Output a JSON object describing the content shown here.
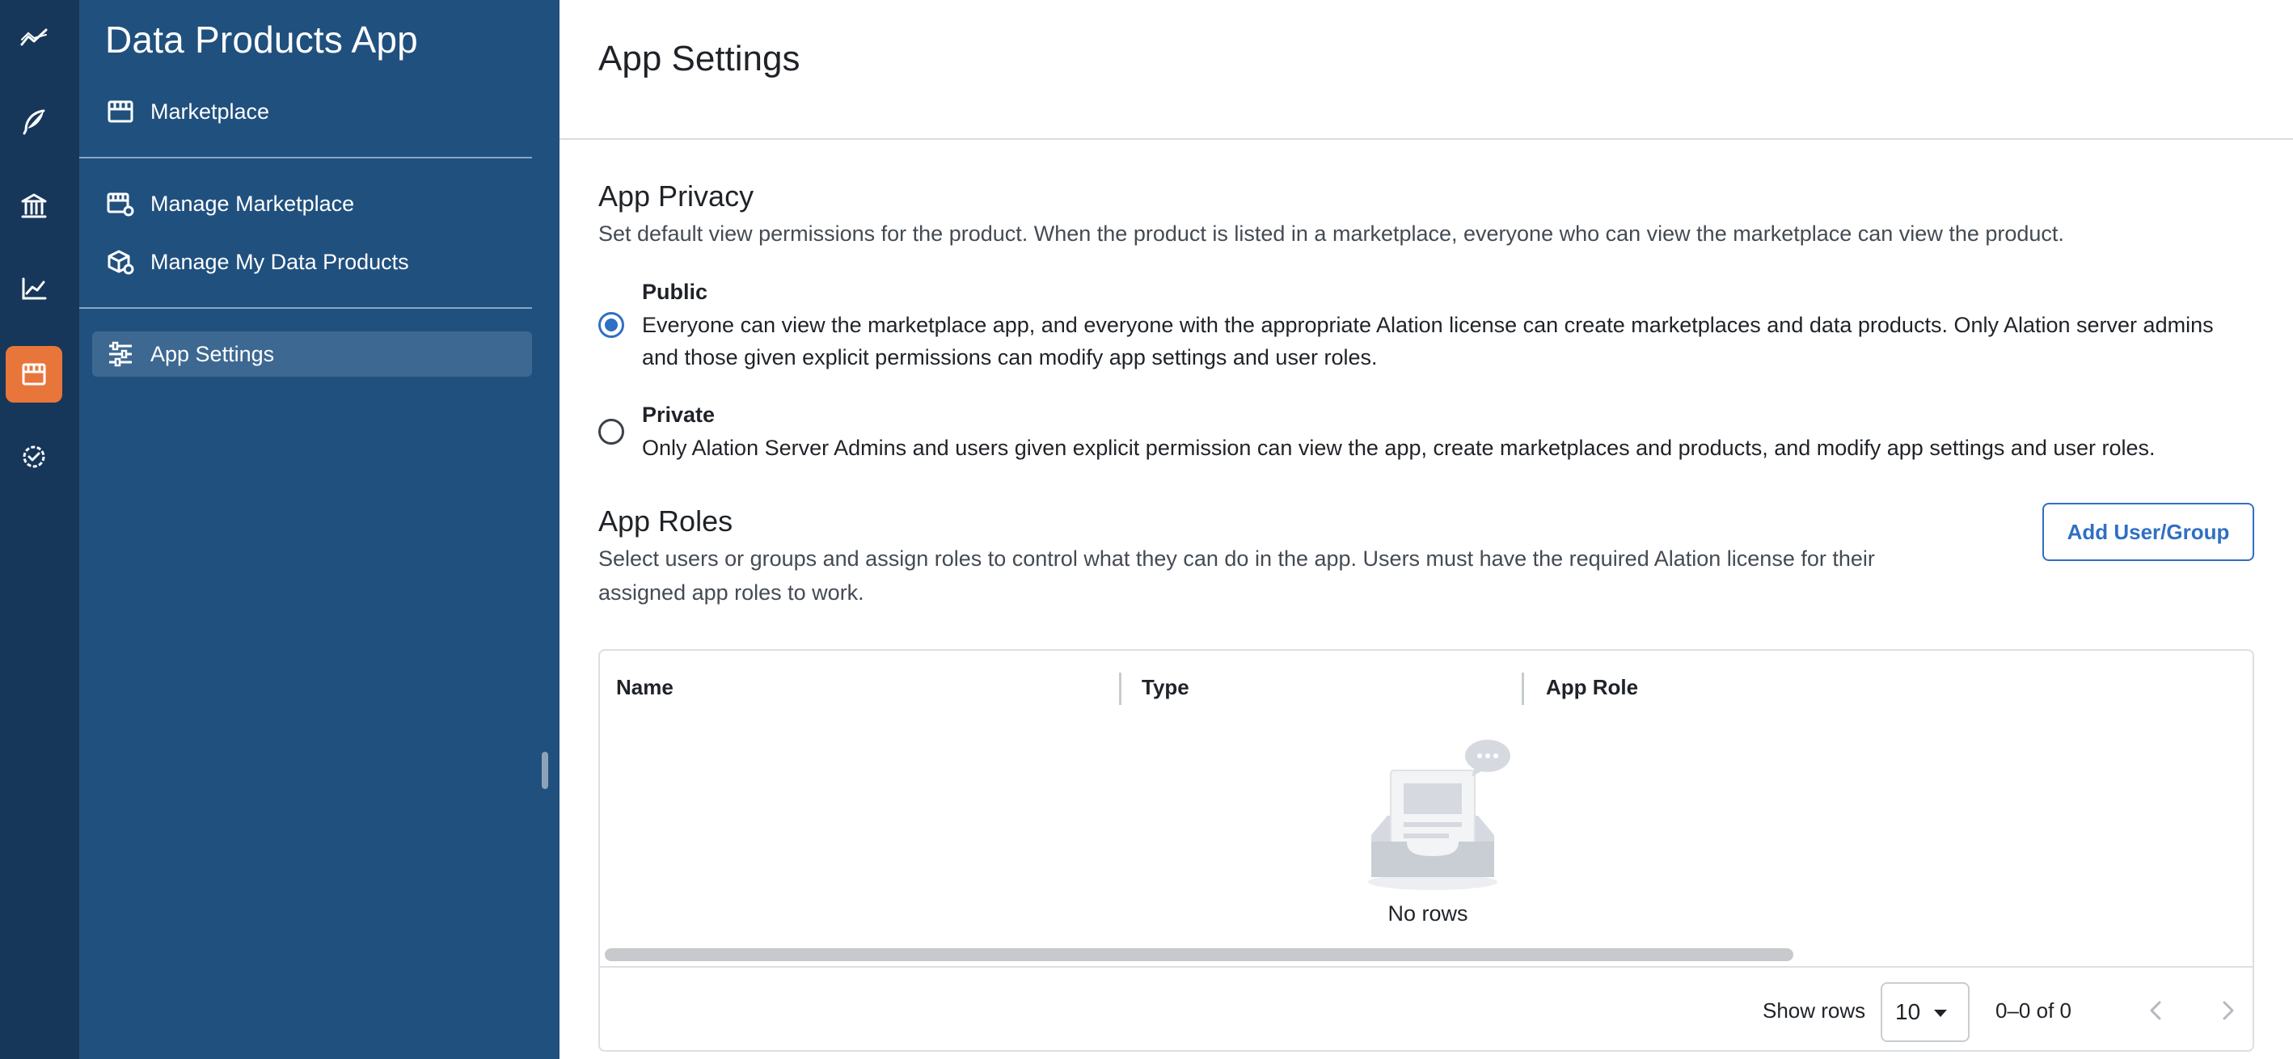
{
  "colors": {
    "rail_bg": "#16375a",
    "nav_bg": "#20507e",
    "nav_active": "#3d6891",
    "accent_orange": "#e8763b",
    "primary_blue": "#2f6fc4"
  },
  "rail": {
    "items": [
      {
        "icon": "analytics-icon"
      },
      {
        "icon": "feather-icon"
      },
      {
        "icon": "bank-icon"
      },
      {
        "icon": "chart-line-icon"
      },
      {
        "icon": "storefront-icon",
        "active": true
      },
      {
        "icon": "verified-gear-icon"
      }
    ]
  },
  "nav": {
    "app_title": "Data Products App",
    "items": [
      {
        "label": "Marketplace",
        "icon": "storefront-icon"
      },
      {
        "label": "Manage Marketplace",
        "icon": "store-settings-icon"
      },
      {
        "label": "Manage My Data Products",
        "icon": "box-settings-icon"
      },
      {
        "label": "App Settings",
        "icon": "sliders-icon",
        "active": true
      }
    ]
  },
  "main": {
    "page_title": "App Settings",
    "privacy": {
      "title": "App Privacy",
      "description": "Set default view permissions for the product. When the product is listed in a marketplace, everyone who can view the marketplace can view the product.",
      "options": [
        {
          "label": "Public",
          "checked": true,
          "desc_line1": "Everyone can view the marketplace app, and everyone with the appropriate Alation license can create marketplaces and data products. Only Alation server admins",
          "desc_line2": "and those given explicit permissions can modify app settings and user roles."
        },
        {
          "label": "Private",
          "checked": false,
          "desc_line1": "Only Alation Server Admins and users given explicit permission can view the app, create marketplaces and products, and modify app settings and user roles."
        }
      ]
    },
    "roles": {
      "title": "App Roles",
      "desc_line1": "Select users or groups and assign roles to control what they can do in the app. Users must have the required Alation license for their",
      "desc_line2": "assigned app roles to work.",
      "add_button": "Add User/Group",
      "table": {
        "columns": [
          "Name",
          "Type",
          "App Role"
        ],
        "rows": [],
        "empty_text": "No rows",
        "show_rows_label": "Show rows",
        "rows_per_page": "10",
        "page_range": "0–0 of 0"
      }
    }
  }
}
